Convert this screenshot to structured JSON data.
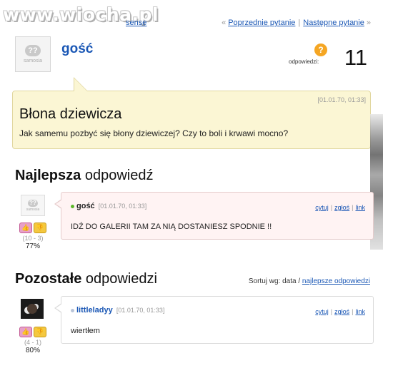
{
  "watermark": "www.wiocha.pl",
  "top_links": {
    "left_partial": "sense",
    "prev": "Poprzednie pytanie",
    "next": "Następne pytanie",
    "prev_arrow": "«",
    "next_arrow": "»"
  },
  "question_header": {
    "asker": "gość",
    "avatar_caption": "samosia",
    "answers_label": "odpowiedzi:",
    "answers_count": "11"
  },
  "question": {
    "timestamp": "[01.01.70, 01:33]",
    "title": "Błona dziewicza",
    "body": "Jak samemu pozbyć się błony dziewiczej? Czy to boli i krwawi mocno?"
  },
  "best_section": {
    "heading_bold": "Najlepsza",
    "heading_rest": " odpowiedź"
  },
  "other_section": {
    "heading_bold": "Pozostałe",
    "heading_rest": " odpowiedzi",
    "sort_label": "Sortuj wg: data / ",
    "sort_link": "najlepsze odpowiedzi"
  },
  "answer_actions": {
    "quote": "cytuj",
    "report": "zgłoś",
    "link": "link"
  },
  "answers": [
    {
      "author": "gość",
      "time": "[01.01.70, 01:33]",
      "text": "IDŹ DO GALERII TAM ZA NIĄ DOSTANIESZ SPODNIE !!",
      "vote_counts": "(10 - 3)",
      "vote_percent": "77%",
      "avatar_caption": "samosia"
    },
    {
      "author": "littleladyy",
      "time": "[01.01.70, 01:33]",
      "text": "wiertłem",
      "vote_counts": "(4 - 1)",
      "vote_percent": "80%"
    }
  ],
  "icons": {
    "question_badge": "?",
    "avatar_bubble": "??",
    "thumb_up": "👍",
    "thumb_down": "👎"
  },
  "colors": {
    "link": "#1a57b5",
    "question_bg": "#fbf6d4",
    "best_answer_bg": "#fff3f3",
    "badge": "#f5a623"
  }
}
